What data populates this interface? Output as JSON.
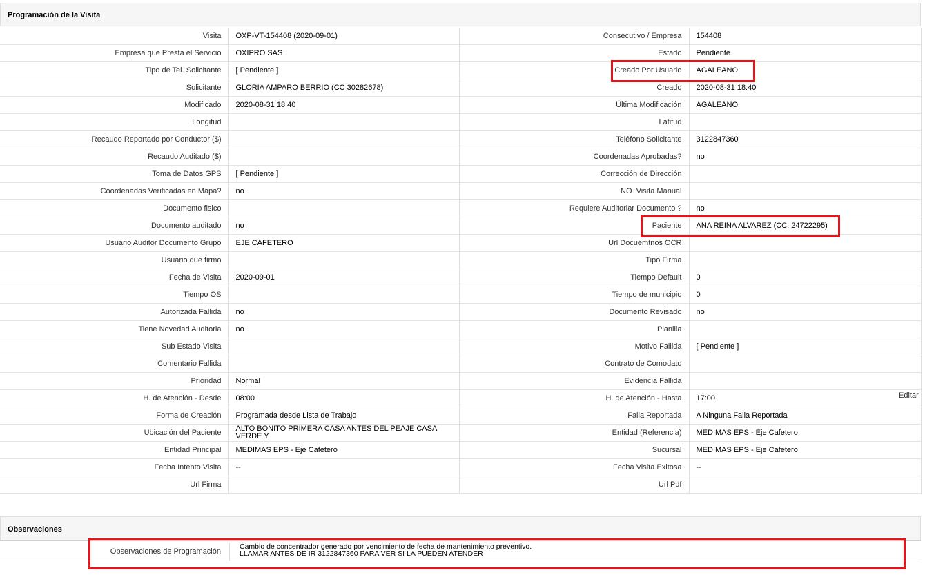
{
  "section1": {
    "title": "Programación de la Visita"
  },
  "section2": {
    "title": "Observaciones"
  },
  "rows": [
    [
      "Visita",
      "OXP-VT-154408 (2020-09-01)",
      "Consecutivo / Empresa",
      "154408"
    ],
    [
      "Empresa que Presta el Servicio",
      "OXIPRO SAS",
      "Estado",
      "Pendiente"
    ],
    [
      "Tipo de Tel. Solicitante",
      "[ Pendiente ]",
      "Creado Por Usuario",
      "AGALEANO"
    ],
    [
      "Solicitante",
      "GLORIA AMPARO BERRIO (CC 30282678)",
      "Creado",
      "2020-08-31 18:40"
    ],
    [
      "Modificado",
      "2020-08-31 18:40",
      "Última Modificación",
      " AGALEANO"
    ],
    [
      "Longitud",
      "",
      "Latitud",
      ""
    ],
    [
      "Recaudo Reportado por Conductor ($)",
      "",
      "Teléfono Solicitante",
      "3122847360"
    ],
    [
      "Recaudo Auditado ($)",
      "",
      "Coordenadas Aprobadas?",
      " no"
    ],
    [
      "Toma de Datos GPS",
      "[ Pendiente ]",
      "Corrección de Dirección",
      ""
    ],
    [
      "Coordenadas Verificadas en Mapa?",
      " no",
      "NO. Visita Manual",
      ""
    ],
    [
      "Documento fisico",
      "",
      "Requiere Auditoriar Documento ?",
      " no"
    ],
    [
      "Documento auditado",
      " no",
      "Paciente",
      "ANA REINA ALVAREZ (CC: 24722295)"
    ],
    [
      "Usuario Auditor Documento Grupo",
      "EJE CAFETERO",
      "Url Docuemtnos OCR",
      ""
    ],
    [
      "Usuario que firmo",
      "",
      "Tipo Firma",
      ""
    ],
    [
      "Fecha de Visita",
      " 2020-09-01",
      "Tiempo Default",
      "0"
    ],
    [
      "Tiempo OS",
      "",
      "Tiempo de municipio",
      "0"
    ],
    [
      "Autorizada Fallida",
      " no",
      "Documento Revisado",
      " no"
    ],
    [
      "Tiene Novedad Auditoria",
      " no",
      "Planilla",
      ""
    ],
    [
      "Sub Estado Visita",
      "",
      "Motivo Fallida",
      "[ Pendiente ]"
    ],
    [
      "Comentario Fallida",
      "",
      "Contrato de Comodato",
      ""
    ],
    [
      "Prioridad",
      "Normal",
      "Evidencia Fallida",
      ""
    ],
    [
      "H. de Atención - Desde",
      "08:00",
      "H. de Atención - Hasta",
      "17:00"
    ],
    [
      "Forma de Creación",
      "Programada desde Lista de Trabajo",
      "Falla Reportada",
      "A Ninguna Falla Reportada"
    ],
    [
      "Ubicación del Paciente",
      "ALTO BONITO PRIMERA CASA ANTES DEL PEAJE CASA VERDE Y",
      "Entidad (Referencia)",
      "MEDIMAS EPS - Eje Cafetero"
    ],
    [
      "Entidad Principal",
      "MEDIMAS EPS - Eje Cafetero",
      "Sucursal",
      "MEDIMAS EPS - Eje Cafetero"
    ],
    [
      "Fecha Intento Visita",
      " --",
      "Fecha Visita Exitosa",
      " --"
    ],
    [
      "Url Firma",
      "",
      "Url Pdf",
      ""
    ]
  ],
  "editar_label": "Editar",
  "observaciones": {
    "label": "Observaciones de Programación",
    "line1": "Cambio de concentrador generado por vencimiento de fecha de mantenimiento preventivo.",
    "line2": "LLAMAR ANTES DE IR 3122847360 PARA VER SI LA PUEDEN ATENDER"
  },
  "colors": {
    "highlight": "#e3151a"
  }
}
